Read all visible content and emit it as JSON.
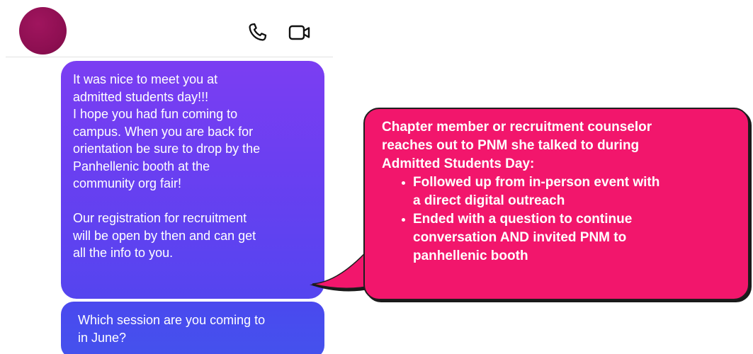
{
  "header": {
    "call_icon": "phone-icon",
    "video_icon": "video-camera-icon",
    "avatar_color": "#8e0f52"
  },
  "messages": [
    {
      "lines": [
        "It was nice to meet you at",
        "admitted students day!!!",
        "I hope you had fun coming to",
        "campus. When you are back for",
        "orientation be sure to drop by the",
        "Panhellenic booth at the",
        "community org fair!",
        "",
        "Our registration for recruitment",
        "will be open by then and can get",
        "all the info to you."
      ]
    },
    {
      "lines": [
        "Which session are you coming to",
        "in June?"
      ]
    }
  ],
  "callout": {
    "intro_lines": [
      "Chapter member or recruitment counselor",
      "reaches out to PNM she talked to during",
      "Admitted Students Day:"
    ],
    "bullets": [
      {
        "lines": [
          "Followed up from in-person event with",
          "a direct digital outreach"
        ]
      },
      {
        "lines": [
          "Ended with a question to continue",
          "conversation AND invited PNM to",
          "panhellenic booth"
        ]
      }
    ],
    "color": "#f2166c"
  }
}
